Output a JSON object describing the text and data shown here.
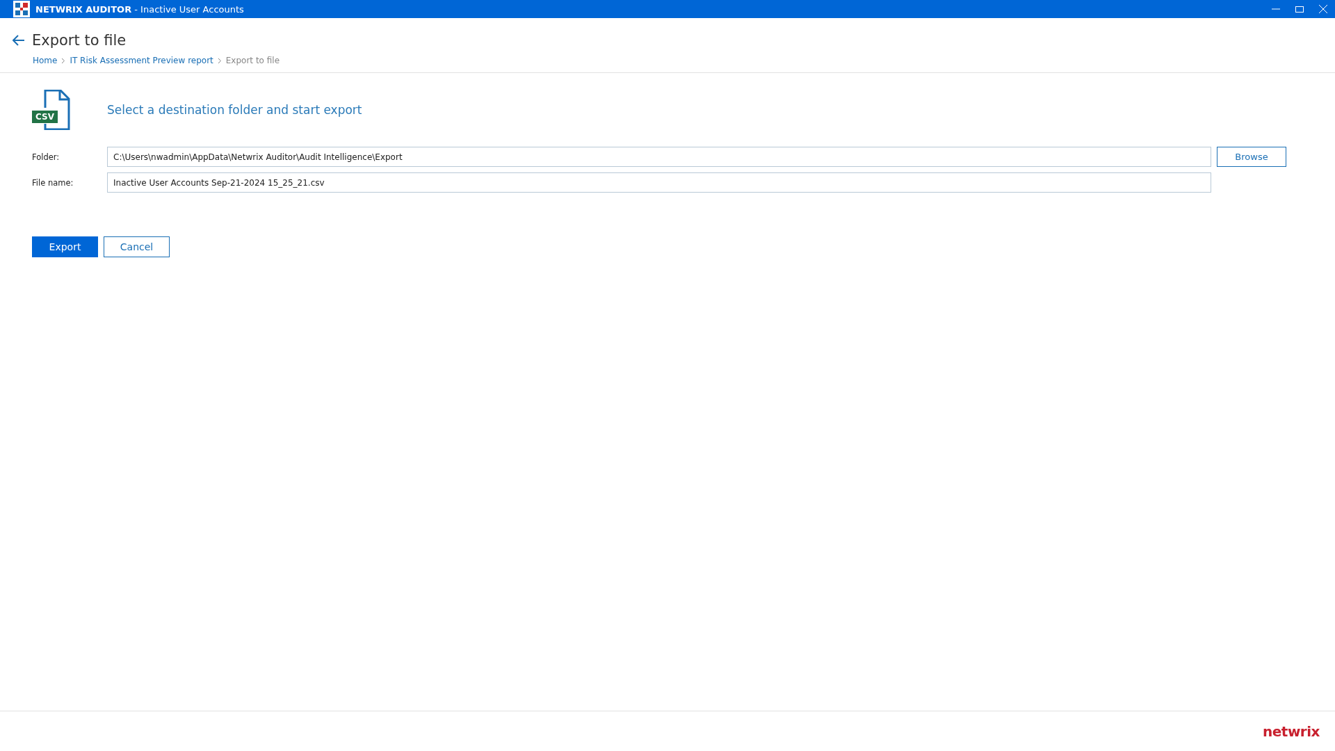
{
  "window": {
    "app": "NETWRIX AUDITOR",
    "title": " - Inactive User Accounts"
  },
  "header": {
    "title": "Export to file",
    "breadcrumb": [
      {
        "label": "Home",
        "current": false
      },
      {
        "label": "IT Risk Assessment Preview report",
        "current": false
      },
      {
        "label": "Export to file",
        "current": true
      }
    ]
  },
  "file_icon_label": "CSV",
  "heading": "Select a destination folder and start export",
  "fields": [
    {
      "label": "Folder:",
      "value": "C:\\Users\\nwadmin\\AppData\\Netwrix Auditor\\Audit Intelligence\\Export",
      "button": "Browse"
    },
    {
      "label": "File name:",
      "value": "Inactive User Accounts Sep-21-2024 15_25_21.csv"
    }
  ],
  "actions": [
    {
      "label": "Export",
      "kind": "primary"
    },
    {
      "label": "Cancel",
      "kind": "secondary"
    }
  ],
  "footer": {
    "logo": "netwrix"
  }
}
